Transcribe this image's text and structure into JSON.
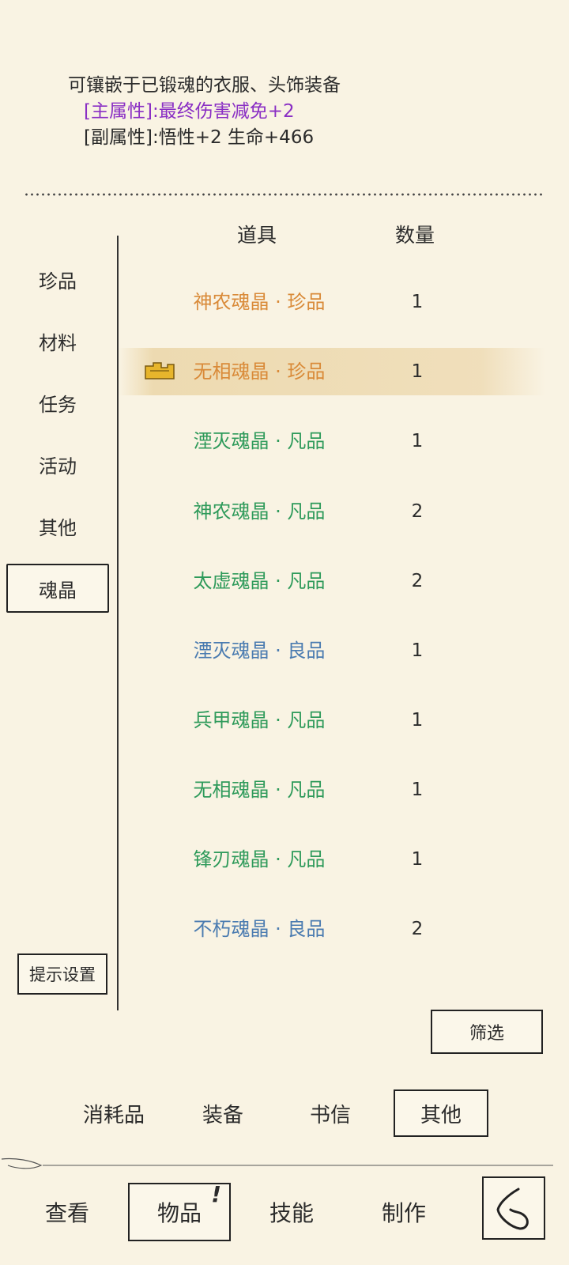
{
  "description": {
    "line1": "可镶嵌于已锻魂的衣服、头饰装备",
    "line2": "[主属性]:最终伤害减免+2",
    "line3": "[副属性]:悟性+2 生命+466"
  },
  "categories": [
    "珍品",
    "材料",
    "任务",
    "活动",
    "其他",
    "魂晶"
  ],
  "active_category": "魂晶",
  "table": {
    "header_item": "道具",
    "header_qty": "数量",
    "rows": [
      {
        "name": "神农魂晶 · 珍品",
        "qty": "1",
        "color": "#d98a38"
      },
      {
        "name": "无相魂晶 · 珍品",
        "qty": "1",
        "color": "#d98a38"
      },
      {
        "name": "湮灭魂晶 · 凡品",
        "qty": "1",
        "color": "#2e9a5a"
      },
      {
        "name": "神农魂晶 · 凡品",
        "qty": "2",
        "color": "#2e9a5a"
      },
      {
        "name": "太虚魂晶 · 凡品",
        "qty": "2",
        "color": "#2e9a5a"
      },
      {
        "name": "湮灭魂晶 · 良品",
        "qty": "1",
        "color": "#4a7bb0"
      },
      {
        "name": "兵甲魂晶 · 凡品",
        "qty": "1",
        "color": "#2e9a5a"
      },
      {
        "name": "无相魂晶 · 凡品",
        "qty": "1",
        "color": "#2e9a5a"
      },
      {
        "name": "锋刃魂晶 · 凡品",
        "qty": "1",
        "color": "#2e9a5a"
      },
      {
        "name": "不朽魂晶 · 良品",
        "qty": "2",
        "color": "#4a7bb0"
      }
    ],
    "selected_row": 1
  },
  "buttons": {
    "hint_settings": "提示设置",
    "filter": "筛选"
  },
  "tabs": [
    "消耗品",
    "装备",
    "书信",
    "其他"
  ],
  "active_tab": "其他",
  "nav": {
    "view": "查看",
    "items": "物品",
    "items_badge": "!",
    "skills": "技能",
    "craft": "制作"
  },
  "icons": {
    "selected_marker": "gold-bracket-marker-icon",
    "back": "back-arrow-icon"
  },
  "colors": {
    "background": "#f9f3e3",
    "rare": "#d98a38",
    "common": "#2e9a5a",
    "good": "#4a7bb0",
    "main_attr": "#8a2fc4"
  }
}
